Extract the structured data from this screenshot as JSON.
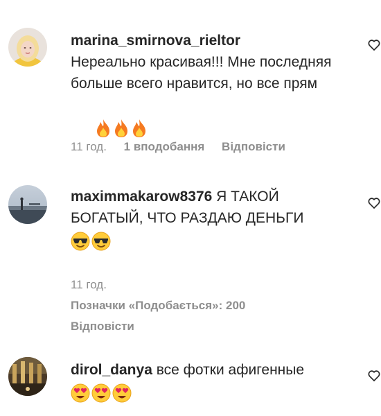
{
  "comments": [
    {
      "username": "marina_smirnova_rieltor",
      "text": "Нереально красивая!!! Мне последняя больше всего нравится, но все прям",
      "emoji": "fire-emoji",
      "emoji_count": 3,
      "time": "11 год.",
      "likes": "1 вподобання",
      "reply": "Відповісти"
    },
    {
      "username": "maximmakarow8376",
      "text": "Я ТАКОЙ БОГАТЫЙ, ЧТО РАЗДАЮ ДЕНЬГИ",
      "emoji": "sunglasses-emoji",
      "emoji_count": 2,
      "time": "11 год.",
      "likes": "Позначки «Подобається»: 200",
      "reply": "Відповісти"
    },
    {
      "username": "dirol_danya",
      "text": "все фотки афигенные",
      "emoji": "heart-eyes-emoji",
      "emoji_count": 3
    }
  ],
  "icons": {
    "like": "heart-outline-icon"
  },
  "colors": {
    "text": "#262626",
    "secondary": "#8e8e8e"
  }
}
